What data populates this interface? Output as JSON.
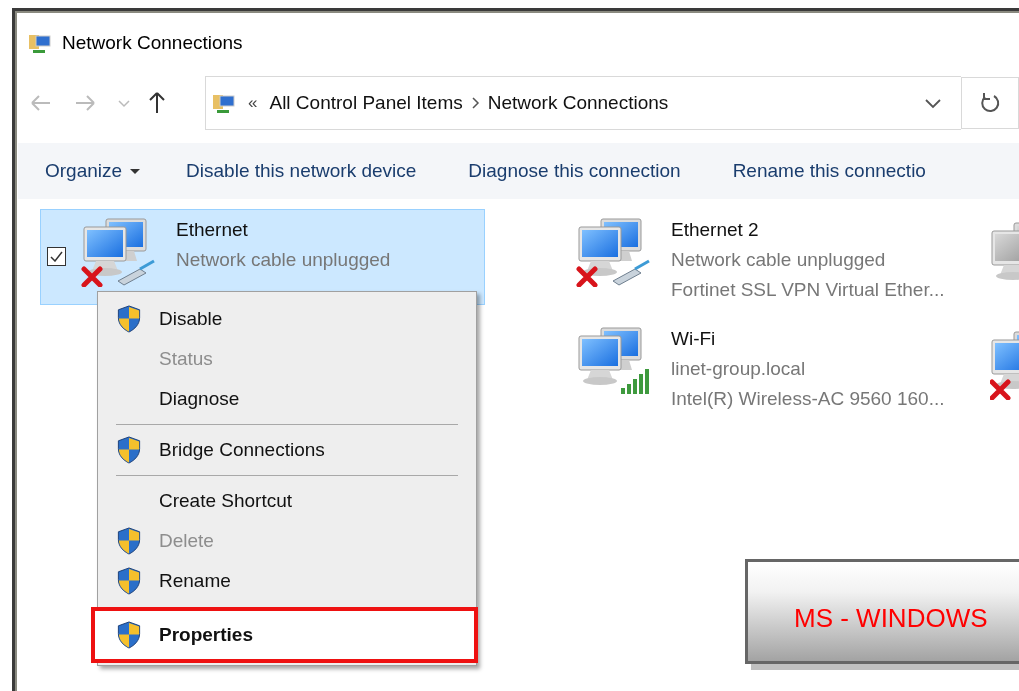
{
  "window": {
    "title": "Network Connections"
  },
  "address_bar": {
    "overflow_glyph": "«",
    "breadcrumb": [
      "All Control Panel Items",
      "Network Connections"
    ]
  },
  "commands": [
    {
      "label": "Organize",
      "kind": "dropdown"
    },
    {
      "label": "Disable this network device",
      "kind": "plain"
    },
    {
      "label": "Diagnose this connection",
      "kind": "plain"
    },
    {
      "label": "Rename this connectio",
      "kind": "plain"
    }
  ],
  "connections": [
    {
      "name": "Ethernet",
      "status": "Network cable unplugged",
      "selected": true,
      "checked": true,
      "kind": "unplugged"
    },
    {
      "name": "Ethernet 2",
      "status": "Network cable unplugged",
      "device": "Fortinet SSL VPN Virtual Ether...",
      "selected": false,
      "checked": false,
      "kind": "unplugged"
    },
    {
      "name": "Wi-Fi",
      "status": "linet-group.local",
      "device": "Intel(R) Wireless-AC 9560 160...",
      "selected": false,
      "checked": false,
      "kind": "wifi"
    }
  ],
  "clipped_connections": [
    {
      "kind": "disabled"
    },
    {
      "kind": "disconnected"
    }
  ],
  "context_menu": {
    "items": [
      {
        "kind": "item",
        "label": "Disable",
        "shield": true,
        "disabled": false,
        "default": false,
        "highlighted": false
      },
      {
        "kind": "item",
        "label": "Status",
        "shield": false,
        "disabled": true,
        "default": false,
        "highlighted": false
      },
      {
        "kind": "item",
        "label": "Diagnose",
        "shield": false,
        "disabled": false,
        "default": false,
        "highlighted": false
      },
      {
        "kind": "separator"
      },
      {
        "kind": "item",
        "label": "Bridge Connections",
        "shield": true,
        "disabled": false,
        "default": false,
        "highlighted": false
      },
      {
        "kind": "separator"
      },
      {
        "kind": "item",
        "label": "Create Shortcut",
        "shield": false,
        "disabled": false,
        "default": false,
        "highlighted": false
      },
      {
        "kind": "item",
        "label": "Delete",
        "shield": true,
        "disabled": true,
        "default": false,
        "highlighted": false
      },
      {
        "kind": "item",
        "label": "Rename",
        "shield": true,
        "disabled": false,
        "default": false,
        "highlighted": false
      },
      {
        "kind": "item",
        "label": "Properties",
        "shield": true,
        "disabled": false,
        "default": true,
        "highlighted": true
      }
    ]
  },
  "caption_label": {
    "text": "MS - WINDOWS"
  }
}
